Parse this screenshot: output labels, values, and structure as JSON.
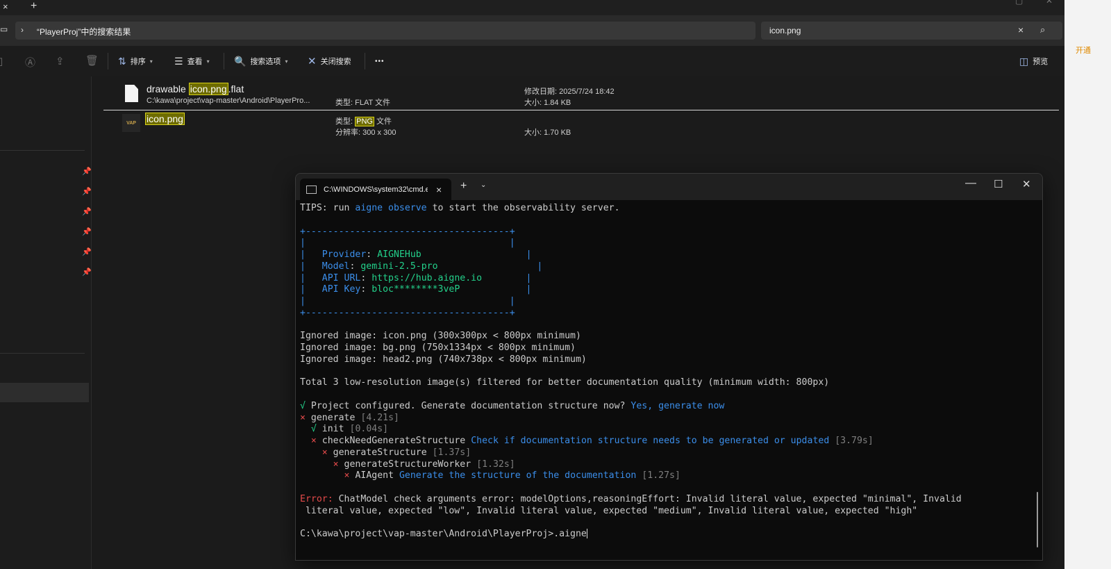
{
  "explorer": {
    "new_tab": "+",
    "breadcrumb": "“PlayerProj”中的搜索结果",
    "search_value": "icon.png",
    "toolbar": {
      "sort": "排序",
      "view": "查看",
      "search_options": "搜索选项",
      "close_search": "关闭搜索",
      "more": "•••",
      "preview": "预览"
    },
    "results": [
      {
        "name_prefix": "drawable ",
        "name_match": "icon.png",
        "name_suffix": ".flat",
        "path": "C:\\kawa\\project\\vap-master\\Android\\PlayerPro...",
        "type": "类型: FLAT 文件",
        "modified": "修改日期: 2025/7/24 18:42",
        "size": "大小: 1.84 KB"
      },
      {
        "name_match": "icon.png",
        "type_prefix": "类型: ",
        "type_match": "PNG",
        "type_suffix": " 文件",
        "resolution": "分辨率: 300 x 300",
        "size": "大小: 1.70 KB",
        "thumb_text": "VAP"
      }
    ],
    "right_strip_text": "开通"
  },
  "cmd": {
    "tab_title": "C:\\WINDOWS\\system32\\cmd.e",
    "lines": {
      "tips_a": "TIPS: run ",
      "tips_b": "aigne observe",
      "tips_c": " to start the observability server.",
      "box_top": "+-------------------------------------+",
      "box_empty": "|                                     |",
      "provider_key": "Provider",
      "provider_val": "AIGNEHub",
      "model_key": "Model",
      "model_val": "gemini-2.5-pro",
      "apiurl_key": "API URL",
      "apiurl_val": "https://hub.aigne.io",
      "apikey_key": "API Key",
      "apikey_val": "bloc********3veP",
      "ign1": "Ignored image: icon.png (300x300px < 800px minimum)",
      "ign2": "Ignored image: bg.png (750x1334px < 800px minimum)",
      "ign3": "Ignored image: head2.png (740x738px < 800px minimum)",
      "total": "Total 3 low-resolution image(s) filtered for better documentation quality (minimum width: 800px)",
      "configured_a": "√",
      "configured_b": " Project configured. Generate documentation structure now? ",
      "configured_c": "Yes, generate now",
      "gen_name": "generate",
      "gen_time": "[4.21s]",
      "init_name": "init",
      "init_time": "[0.04s]",
      "check_name": "checkNeedGenerateStructure",
      "check_desc": "Check if documentation structure needs to be generated or updated",
      "check_time": "[3.79s]",
      "gs_name": "generateStructure",
      "gs_time": "[1.37s]",
      "gsw_name": "generateStructureWorker",
      "gsw_time": "[1.32s]",
      "ai_name": "AIAgent",
      "ai_desc": "Generate the structure of the documentation",
      "ai_time": "[1.27s]",
      "error_label": "Error:",
      "error_1": " ChatModel check arguments error: modelOptions,reasoningEffort: Invalid literal value, expected \"minimal\", Invalid",
      "error_2": " literal value, expected \"low\", Invalid literal value, expected \"medium\", Invalid literal value, expected \"high\"",
      "prompt": "C:\\kawa\\project\\vap-master\\Android\\PlayerProj>.aigne",
      "x_mark": "×",
      "check_mark": "√"
    }
  }
}
